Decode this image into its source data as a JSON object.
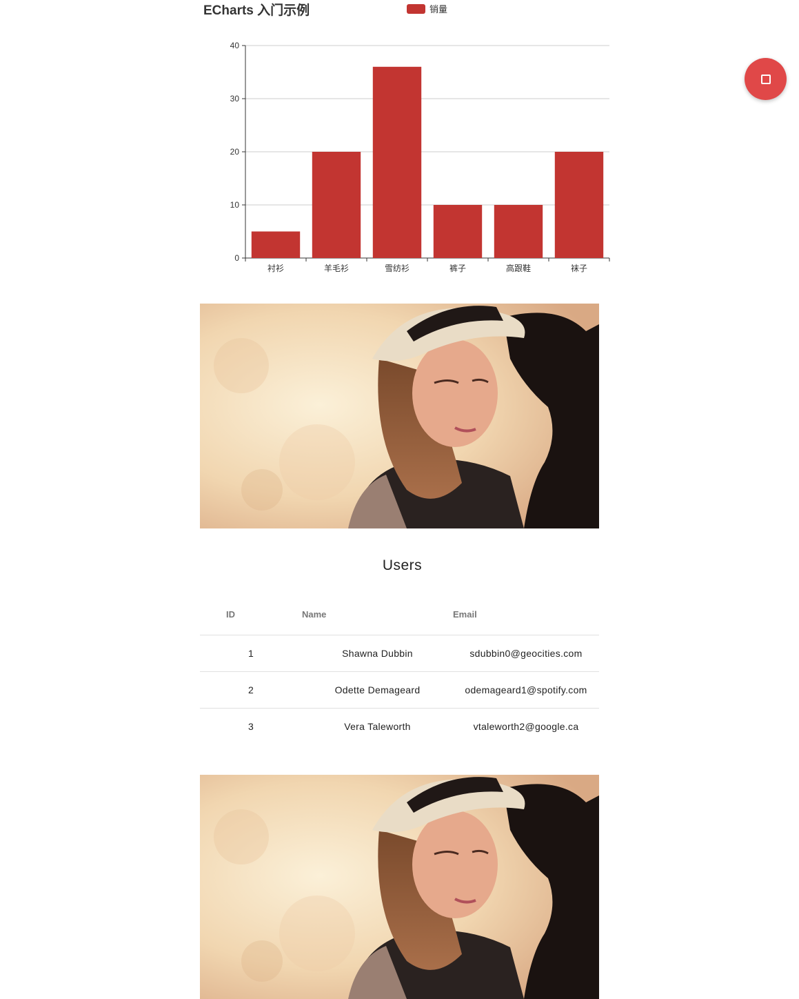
{
  "chart_data": {
    "type": "bar",
    "title": "ECharts 入门示例",
    "legend": [
      "销量"
    ],
    "legend_position": "top",
    "categories": [
      "衬衫",
      "羊毛衫",
      "雪纺衫",
      "裤子",
      "高跟鞋",
      "袜子"
    ],
    "series": [
      {
        "name": "销量",
        "values": [
          5,
          20,
          36,
          10,
          10,
          20
        ]
      }
    ],
    "ylim": [
      0,
      40
    ],
    "yticks": [
      "0",
      "10",
      "20",
      "30",
      "40"
    ],
    "grid": true,
    "color": "#c23531"
  },
  "fab": {
    "icon": "stop-square-icon",
    "color": "#e04848"
  },
  "images": {
    "photo_1": "portrait-photo",
    "photo_2": "portrait-photo"
  },
  "users": {
    "title": "Users",
    "columns": [
      "ID",
      "Name",
      "Email"
    ],
    "rows": [
      {
        "id": "1",
        "name": "Shawna Dubbin",
        "email": "sdubbin0@geocities.com"
      },
      {
        "id": "2",
        "name": "Odette Demageard",
        "email": "odemageard1@spotify.com"
      },
      {
        "id": "3",
        "name": "Vera Taleworth",
        "email": "vtaleworth2@google.ca"
      }
    ]
  }
}
